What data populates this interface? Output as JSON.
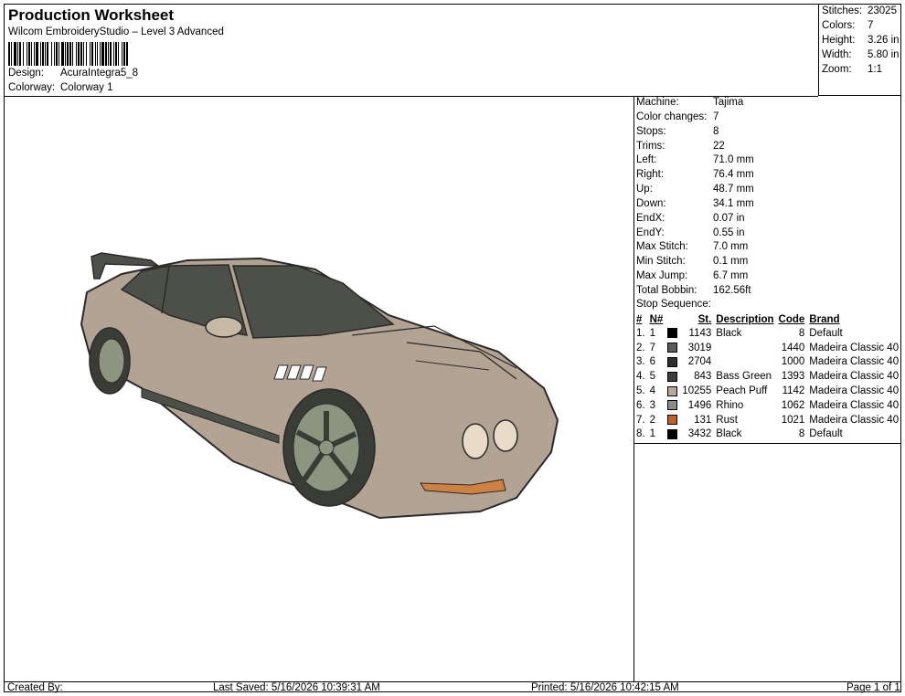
{
  "header": {
    "title": "Production Worksheet",
    "subtitle": "Wilcom EmbroideryStudio – Level 3 Advanced",
    "design_label": "Design:",
    "design_value": "AcuraIntegra5_8",
    "colorway_label": "Colorway:",
    "colorway_value": "Colorway 1"
  },
  "stats": [
    {
      "k": "Stitches:",
      "v": "23025"
    },
    {
      "k": "Colors:",
      "v": "7"
    },
    {
      "k": "Height:",
      "v": "3.26 in"
    },
    {
      "k": "Width:",
      "v": "5.80 in"
    },
    {
      "k": "Zoom:",
      "v": "1:1"
    }
  ],
  "details": [
    {
      "k": "Machine:",
      "v": "Tajima"
    },
    {
      "k": "Color changes:",
      "v": "7"
    },
    {
      "k": "Stops:",
      "v": "8"
    },
    {
      "k": "Trims:",
      "v": "22"
    },
    {
      "k": "Left:",
      "v": "71.0 mm"
    },
    {
      "k": "Right:",
      "v": "76.4 mm"
    },
    {
      "k": "Up:",
      "v": "48.7 mm"
    },
    {
      "k": "Down:",
      "v": "34.1 mm"
    },
    {
      "k": "EndX:",
      "v": "0.07 in"
    },
    {
      "k": "EndY:",
      "v": "0.55 in"
    },
    {
      "k": "Max Stitch:",
      "v": "7.0 mm"
    },
    {
      "k": "Min Stitch:",
      "v": "0.1 mm"
    },
    {
      "k": "Max Jump:",
      "v": "6.7 mm"
    },
    {
      "k": "Total Bobbin:",
      "v": "162.56ft"
    }
  ],
  "stop_sequence_label": "Stop Sequence:",
  "stop_headers": {
    "num": "#",
    "n": "N#",
    "st": "St.",
    "desc": "Description",
    "code": "Code",
    "brand": "Brand"
  },
  "stops": [
    {
      "num": "1.",
      "n": "1",
      "color": "#000000",
      "st": "1143",
      "desc": "Black",
      "code": "8",
      "brand": "Default"
    },
    {
      "num": "2.",
      "n": "7",
      "color": "#5a5a5a",
      "st": "3019",
      "desc": "",
      "code": "1440",
      "brand": "Madeira Classic 40"
    },
    {
      "num": "3.",
      "n": "6",
      "color": "#2e2e2e",
      "st": "2704",
      "desc": "",
      "code": "1000",
      "brand": "Madeira Classic 40"
    },
    {
      "num": "4.",
      "n": "5",
      "color": "#3b3d38",
      "st": "843",
      "desc": "Bass Green",
      "code": "1393",
      "brand": "Madeira Classic 40"
    },
    {
      "num": "5.",
      "n": "4",
      "color": "#b8a69a",
      "st": "10255",
      "desc": "Peach Puff",
      "code": "1142",
      "brand": "Madeira Classic 40"
    },
    {
      "num": "6.",
      "n": "3",
      "color": "#8c8c88",
      "st": "1496",
      "desc": "Rhino",
      "code": "1062",
      "brand": "Madeira Classic 40"
    },
    {
      "num": "7.",
      "n": "2",
      "color": "#c4601e",
      "st": "131",
      "desc": "Rust",
      "code": "1021",
      "brand": "Madeira Classic 40"
    },
    {
      "num": "8.",
      "n": "1",
      "color": "#000000",
      "st": "3432",
      "desc": "Black",
      "code": "8",
      "brand": "Default"
    }
  ],
  "footer": {
    "created": "Created By:",
    "saved": "Last Saved: 5/16/2026 10:39:31 AM",
    "printed": "Printed: 5/16/2026 10:42:15 AM",
    "page": "Page 1 of 1"
  },
  "car_colors": {
    "body": "#b3a393",
    "glass": "#4d5048",
    "outline": "#2a2a2a",
    "tire": "#3a3d36",
    "rim": "#8e9480",
    "light": "#d08040"
  }
}
